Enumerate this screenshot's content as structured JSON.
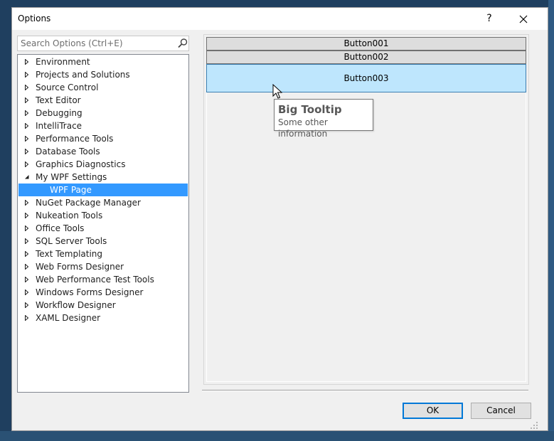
{
  "window": {
    "title": "Options",
    "help_glyph": "?"
  },
  "search": {
    "placeholder": "Search Options (Ctrl+E)"
  },
  "tree": {
    "items": [
      {
        "label": "Environment"
      },
      {
        "label": "Projects and Solutions"
      },
      {
        "label": "Source Control"
      },
      {
        "label": "Text Editor"
      },
      {
        "label": "Debugging"
      },
      {
        "label": "IntelliTrace"
      },
      {
        "label": "Performance Tools"
      },
      {
        "label": "Database Tools"
      },
      {
        "label": "Graphics Diagnostics"
      },
      {
        "label": "My WPF Settings"
      },
      {
        "label": "WPF Page"
      },
      {
        "label": "NuGet Package Manager"
      },
      {
        "label": "Nukeation Tools"
      },
      {
        "label": "Office Tools"
      },
      {
        "label": "SQL Server Tools"
      },
      {
        "label": "Text Templating"
      },
      {
        "label": "Web Forms Designer"
      },
      {
        "label": "Web Performance Test Tools"
      },
      {
        "label": "Windows Forms Designer"
      },
      {
        "label": "Workflow Designer"
      },
      {
        "label": "XAML Designer"
      }
    ]
  },
  "page": {
    "buttons": [
      {
        "label": "Button001"
      },
      {
        "label": "Button002"
      },
      {
        "label": "Button003"
      }
    ],
    "tooltip": {
      "title": "Big Tooltip",
      "body": "Some other information"
    }
  },
  "footer": {
    "ok_label": "OK",
    "cancel_label": "Cancel"
  },
  "colors": {
    "selection": "#3399ff",
    "hover_button": "#bee6fd",
    "default_button_border": "#0078d7"
  }
}
